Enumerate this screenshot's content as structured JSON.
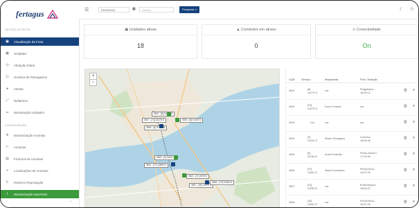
{
  "brand": {
    "name": "fertagus"
  },
  "sidebar": {
    "section_fleet": "GESTÃO DA FROTA",
    "items_fleet": [
      {
        "label": "Visualização da Frota",
        "icon": "train-icon"
      },
      {
        "label": "Unidades",
        "icon": "train-icon"
      },
      {
        "label": "Afetação Diária",
        "icon": "clock-icon"
      },
      {
        "label": "Horários de Passageiros",
        "icon": "list-icon"
      },
      {
        "label": "Alertas",
        "icon": "bell-icon"
      },
      {
        "label": "Relatórios",
        "icon": "chart-icon"
      },
      {
        "label": "Monitoração Unidades",
        "icon": "sliders-icon"
      }
    ],
    "section_config": "CONFIGURAÇÃO",
    "items_config": [
      {
        "label": "Monitorização Anomias",
        "icon": "gear-icon"
      },
      {
        "label": "Anomias",
        "icon": "tool-icon"
      },
      {
        "label": "Ficheiros de Anomias",
        "icon": "file-icon"
      },
      {
        "label": "Localizações de Anomias",
        "icon": "pin-icon"
      },
      {
        "label": "Histórico Reprodução",
        "icon": "history-icon"
      },
      {
        "label": "Monitorização NextTrack",
        "icon": "wave-icon"
      }
    ]
  },
  "topbar": {
    "date": "01/02/2024",
    "service_placeholder": "Serviço",
    "search_label": "Pesquisar"
  },
  "cards": [
    {
      "title": "Unidades ativas",
      "value": "18",
      "icon": "train-icon"
    },
    {
      "title": "Comboios em atraso",
      "value": "0",
      "icon": "warning-icon"
    },
    {
      "title": "Conectividade",
      "value": "On",
      "icon": "link-icon"
    }
  ],
  "map": {
    "labels": [
      "3517 - [74] 14278 S",
      "3509 - [4] 20744 N",
      "3503 - [8] 14225 S",
      "3501 - [8] 14079 S",
      "3519 - [2] 14231 S",
      "3511 - [77] 14860 N",
      "3521 - [7] 14978 S",
      "3507 - [39] 14970 S",
      "3506 - [73] 14283 S"
    ]
  },
  "table": {
    "headers": [
      "UQE",
      "Serviço",
      "Maquinista",
      "Próx. Estação"
    ],
    "rows": [
      {
        "uqe": "3501",
        "servico": "[8]\n14079 S",
        "maquinista": "n/a",
        "estacao": "Pragal/ardo -\n16:35:13"
      },
      {
        "uqe": "3502",
        "servico": "[23]\n14075 S",
        "maquinista": "Nuno Ferreira",
        "estacao": "n/a"
      },
      {
        "uqe": "3503",
        "servico": "n/a",
        "maquinista": "n/a",
        "estacao": "n/a"
      },
      {
        "uqe": "3504",
        "servico": "[2]\n14231 S",
        "maquinista": "Álvaro Rodrigues",
        "estacao": "Corroios -\n18:59:38"
      },
      {
        "uqe": "3505",
        "servico": "[3]\n20784 N",
        "maquinista": "André Estevão",
        "estacao": "Roma-Areeiro -\n17:03:39"
      },
      {
        "uqe": "3506",
        "servico": "[37]\n14261 S",
        "maquinista": "Maria Gonçalves",
        "estacao": "Pinhal Novo -\n16:57:25"
      },
      {
        "uqe": "3507",
        "servico": "[13]\n14230 N",
        "maquinista": "n/a",
        "estacao": "Entrecampos -\n16:54:21"
      },
      {
        "uqe": "3508",
        "servico": "[16]\n14261 S",
        "maquinista": "n/a",
        "estacao": "Pinhal Novo -\n16:57:25"
      }
    ]
  },
  "colors": {
    "primary": "#16437e",
    "green": "#3b9a3b",
    "on": "#3bb34a"
  }
}
